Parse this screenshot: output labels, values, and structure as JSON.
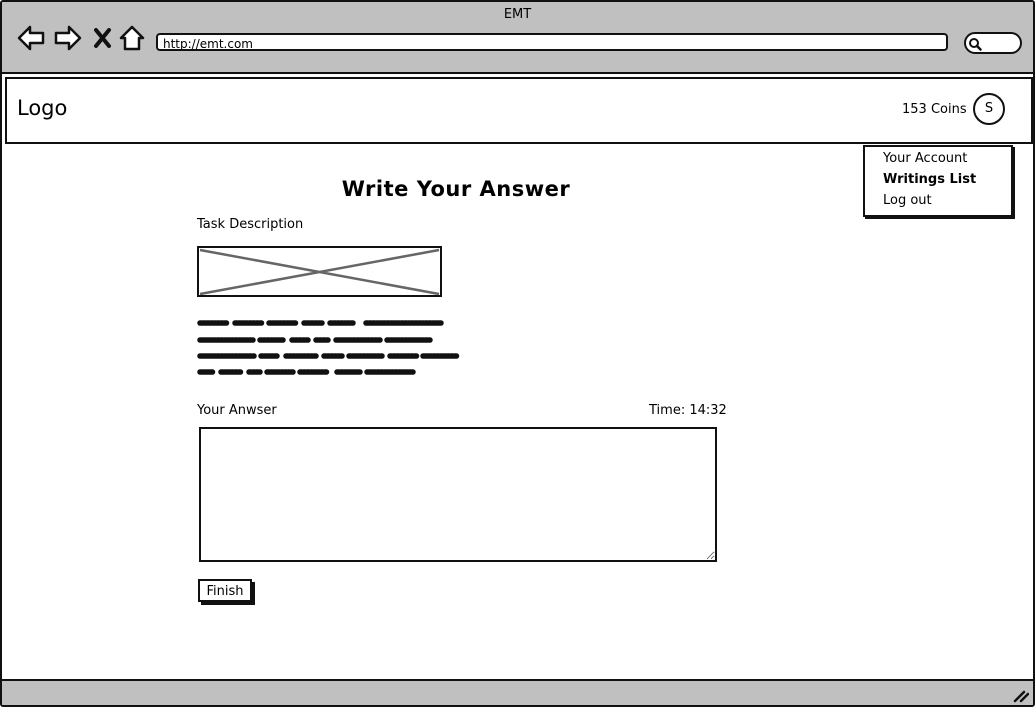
{
  "browser": {
    "title": "EMT",
    "url": "http://emt.com",
    "icons": [
      "back-arrow-icon",
      "forward-arrow-icon",
      "close-icon",
      "home-icon",
      "search-icon"
    ]
  },
  "header": {
    "logo": "Logo",
    "coins": "153 Coins",
    "avatar_initial": "S"
  },
  "menu": {
    "items": [
      {
        "label": "Your Account",
        "bold": false
      },
      {
        "label": "Writings List",
        "bold": true
      },
      {
        "label": "Log out",
        "bold": false
      }
    ]
  },
  "main": {
    "title": "Write Your Answer",
    "task_label": "Task Description",
    "answer_label": "Your Anwser",
    "timer": "Time: 14:32",
    "answer_value": "",
    "finish_label": "Finish"
  },
  "colors": {
    "chrome": "#c0c0c0",
    "ink": "#111111",
    "background": "#ffffff"
  }
}
